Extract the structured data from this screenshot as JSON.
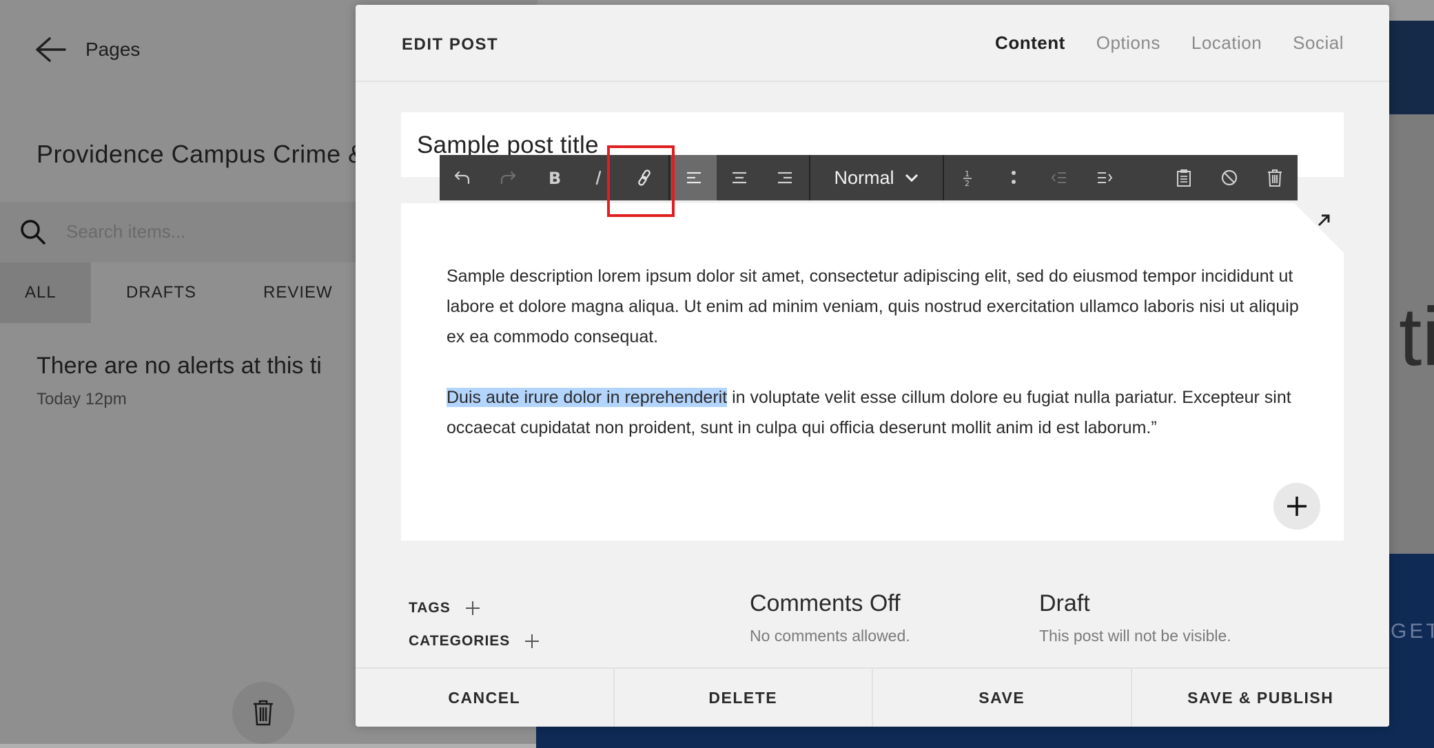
{
  "background": {
    "back_label": "Pages",
    "site_title": "Providence Campus Crime &",
    "search_placeholder": "Search items...",
    "tabs": [
      "ALL",
      "DRAFTS",
      "REVIEW"
    ],
    "alert_title": "There are no alerts at this ti",
    "alert_time": "Today 12pm",
    "right_letters": "ti",
    "right_button_text": "GET"
  },
  "modal": {
    "title": "EDIT POST",
    "tabs": [
      {
        "label": "Content",
        "active": true
      },
      {
        "label": "Options",
        "active": false
      },
      {
        "label": "Location",
        "active": false
      },
      {
        "label": "Social",
        "active": false
      }
    ],
    "post_title": "Sample post title",
    "toolbar": {
      "style_label": "Normal",
      "buttons": [
        "undo-icon",
        "redo-icon",
        "bold-icon",
        "italic-icon",
        "link-icon",
        "align-left-icon",
        "align-center-icon",
        "align-right-icon",
        "style-dropdown",
        "ordered-list-icon",
        "bullet-list-icon",
        "outdent-icon",
        "indent-icon",
        "paste-icon",
        "clear-format-icon",
        "delete-icon"
      ],
      "active": "align-left-icon",
      "highlighted": "link-icon"
    },
    "body": {
      "p1": "Sample description lorem ipsum dolor sit amet, consectetur adipiscing elit, sed do eiusmod tempor incididunt ut labore et dolore magna aliqua. Ut enim ad minim veniam, quis nostrud exercitation ullamco laboris nisi ut aliquip ex ea commodo consequat.",
      "p2_selected": "Duis aute irure dolor in reprehenderit",
      "p2_rest": " in voluptate velit esse cillum dolore eu fugiat nulla pariatur. Excepteur sint occaecat cupidatat non proident, sunt in culpa qui officia deserunt mollit anim id est laborum.”"
    },
    "meta": {
      "tags_label": "TAGS",
      "categories_label": "CATEGORIES",
      "comments_heading": "Comments Off",
      "comments_sub": "No comments allowed.",
      "status_heading": "Draft",
      "status_sub": "This post will not be visible."
    },
    "footer": {
      "cancel": "CANCEL",
      "delete": "DELETE",
      "save": "SAVE",
      "publish": "SAVE & PUBLISH"
    }
  },
  "colors": {
    "highlight_box": "#e02020",
    "selection": "#b3d4fc",
    "toolbar": "#3f3f3f",
    "navy": "#0f2a55"
  }
}
